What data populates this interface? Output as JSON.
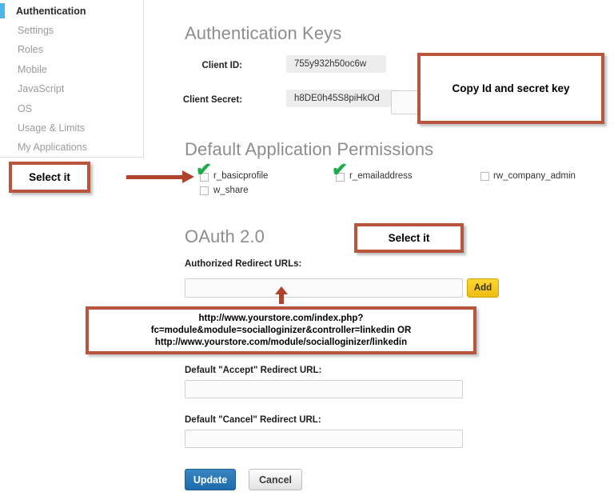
{
  "sidebar": {
    "items": [
      {
        "label": "Authentication",
        "active": true
      },
      {
        "label": "Settings",
        "active": false
      },
      {
        "label": "Roles",
        "active": false
      },
      {
        "label": "Mobile",
        "active": false
      },
      {
        "label": "JavaScript",
        "active": false
      },
      {
        "label": "OS",
        "active": false
      },
      {
        "label": "Usage & Limits",
        "active": false
      },
      {
        "label": "My Applications",
        "active": false
      }
    ]
  },
  "auth_keys": {
    "title": "Authentication Keys",
    "client_id_label": "Client ID:",
    "client_id_value": "755y932h50oc6w",
    "client_secret_label": "Client Secret:",
    "client_secret_value": "h8DE0h45S8piHkOd"
  },
  "permissions": {
    "title": "Default Application Permissions",
    "items": [
      {
        "label": "r_basicprofile",
        "checked": true
      },
      {
        "label": "w_share",
        "checked": false
      },
      {
        "label": "r_emailaddress",
        "checked": true
      },
      {
        "label": "rw_company_admin",
        "checked": false
      }
    ]
  },
  "oauth": {
    "title": "OAuth 2.0",
    "redirect_label": "Authorized Redirect URLs:",
    "redirect_value": "",
    "redirect_placeholder": "",
    "add_label": "Add",
    "accept_label": "Default \"Accept\" Redirect URL:",
    "accept_value": "",
    "cancel_redirect_label": "Default \"Cancel\" Redirect URL:",
    "cancel_redirect_value": "",
    "update_label": "Update",
    "cancel_label": "Cancel"
  },
  "annotations": {
    "copy_keys": "Copy Id and secret key",
    "select_permissions": "Select it",
    "select_oauth": "Select it",
    "url_line1": "http://www.yourstore.com/index.php?",
    "url_line2": "fc=module&module=socialloginizer&controller=linkedin OR",
    "url_line3": "http://www.yourstore.com/module/socialloginizer/linkedin"
  },
  "colors": {
    "annotation_border": "#b9543d",
    "arrow": "#b0432c",
    "checkmark_green": "#1faa4b",
    "sidebar_active_marker": "#4bb7e8",
    "add_button": "#f0bd13",
    "update_button": "#1c6bab"
  }
}
